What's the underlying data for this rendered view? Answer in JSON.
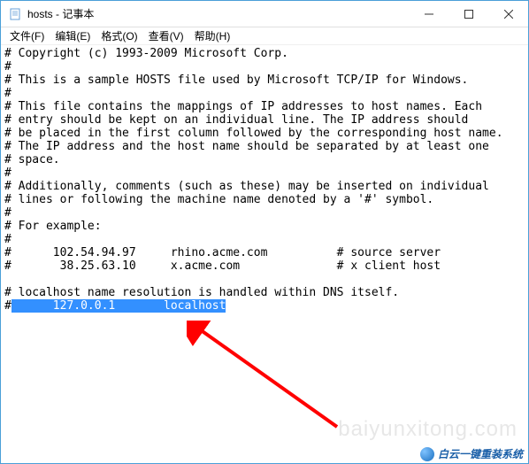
{
  "titlebar": {
    "title": "hosts - 记事本"
  },
  "menu": {
    "file": "文件(F)",
    "edit": "编辑(E)",
    "format": "格式(O)",
    "view": "查看(V)",
    "help": "帮助(H)"
  },
  "content": {
    "l1": "# Copyright (c) 1993-2009 Microsoft Corp.",
    "l2": "#",
    "l3": "# This is a sample HOSTS file used by Microsoft TCP/IP for Windows.",
    "l4": "#",
    "l5": "# This file contains the mappings of IP addresses to host names. Each",
    "l6": "# entry should be kept on an individual line. The IP address should",
    "l7": "# be placed in the first column followed by the corresponding host name.",
    "l8": "# The IP address and the host name should be separated by at least one",
    "l9": "# space.",
    "l10": "#",
    "l11": "# Additionally, comments (such as these) may be inserted on individual",
    "l12": "# lines or following the machine name denoted by a '#' symbol.",
    "l13": "#",
    "l14": "# For example:",
    "l15": "#",
    "l16": "#      102.54.94.97     rhino.acme.com          # source server",
    "l17": "#       38.25.63.10     x.acme.com              # x client host",
    "l18": "",
    "l19": "# localhost name resolution is handled within DNS itself.",
    "l20a": "#",
    "l20b": "      127.0.0.1       localhost"
  },
  "watermark": "baiyunxitong.com",
  "brand": "白云一键重装系统"
}
